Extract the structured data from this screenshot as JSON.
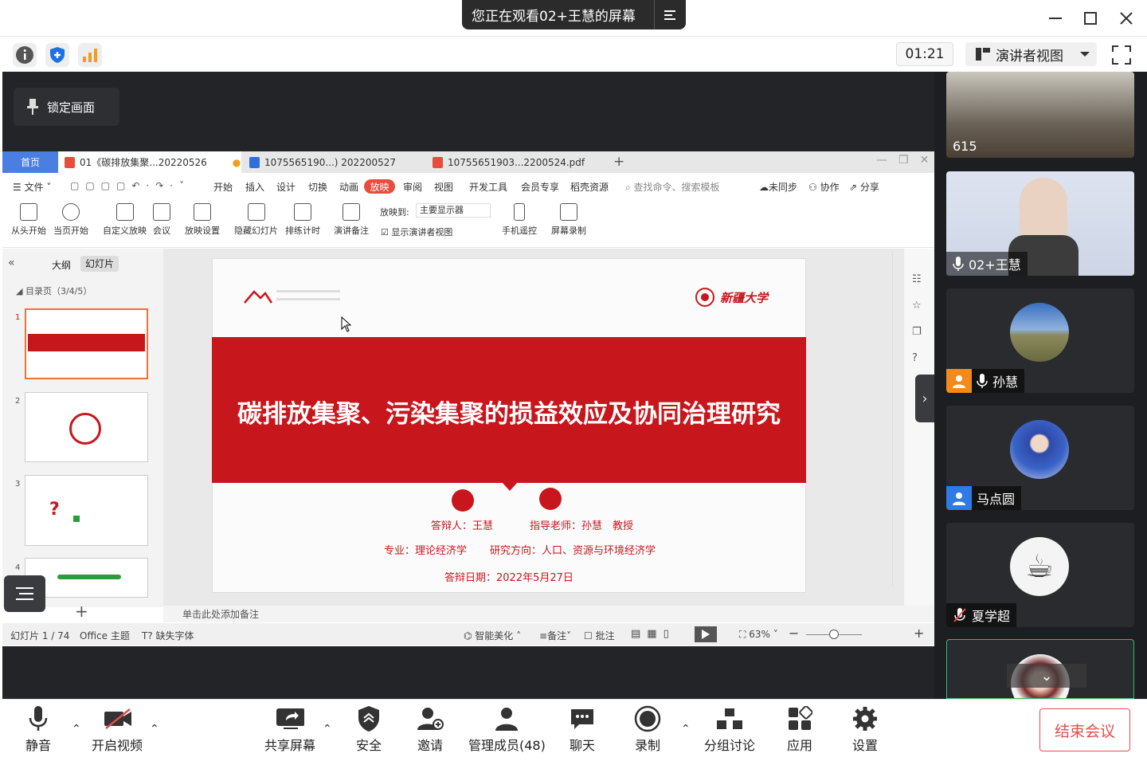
{
  "titlebar": {
    "share_banner": "您正在观看02+王慧的屏幕",
    "menu_icon": "list-icon"
  },
  "toolbar": {
    "timer": "01:21",
    "view_label": "演讲者视图",
    "lock_label": "锁定画面"
  },
  "wps": {
    "tabs": [
      "首页",
      "01《碳排放集聚...20220526",
      "1075565190...) 202200527",
      "10755651903...2200524.pdf"
    ],
    "menu": [
      "文件",
      "开始",
      "插入",
      "设计",
      "切换",
      "动画",
      "放映",
      "审阅",
      "视图",
      "开发工具",
      "会员专享",
      "稻壳资源"
    ],
    "search_placeholder": "查找命令、搜索模板",
    "sync": "未同步",
    "collab": "协作",
    "share": "分享",
    "ribbon": [
      "从头开始",
      "当页开始",
      "自定义放映",
      "会议",
      "放映设置",
      "隐藏幻灯片",
      "排练计时",
      "演讲备注",
      "手机遥控",
      "屏幕录制"
    ],
    "play_to_label": "放映到:",
    "play_to_value": "主要显示器",
    "presenter_view_check": "显示演讲者视图",
    "pane_tabs": [
      "大纲",
      "幻灯片"
    ],
    "outline_title": "目录页（3/4/5）",
    "slide_numbers": [
      "1",
      "2",
      "3",
      "4"
    ],
    "notes_placeholder": "单击此处添加备注",
    "status": {
      "slide_count": "幻灯片 1 / 74",
      "theme": "Office 主题",
      "missing_font": "缺失字体",
      "beautify": "智能美化",
      "notes": "备注",
      "comment": "批注",
      "zoom": "63%"
    }
  },
  "slide": {
    "title": "碳排放集聚、污染集聚的损益效应及协同治理研究",
    "defender": "答辩人：王慧",
    "advisor": "指导老师：孙慧　教授",
    "major": "专业：理论经济学",
    "direction": "研究方向：人口、资源与环境经济学",
    "date": "答辩日期：2022年5月27日",
    "university": "新疆大学"
  },
  "participants": [
    {
      "name": "615",
      "icon": "none"
    },
    {
      "name": "02+王慧",
      "icon": "mic-icon"
    },
    {
      "name": "孙慧",
      "icon": "mic-icon"
    },
    {
      "name": "马点圆",
      "icon": "user-icon"
    },
    {
      "name": "夏学超",
      "icon": "mic-muted-icon"
    }
  ],
  "bottom": {
    "mute": "静音",
    "video": "开启视频",
    "share": "共享屏幕",
    "security": "安全",
    "invite": "邀请",
    "members": "管理成员(48)",
    "chat": "聊天",
    "record": "录制",
    "breakout": "分组讨论",
    "apps": "应用",
    "settings": "设置",
    "end": "结束会议"
  },
  "colors": {
    "accent_red": "#c8161d",
    "wps_active_tab": "#e84c3d",
    "end_red": "#e34d4d"
  }
}
